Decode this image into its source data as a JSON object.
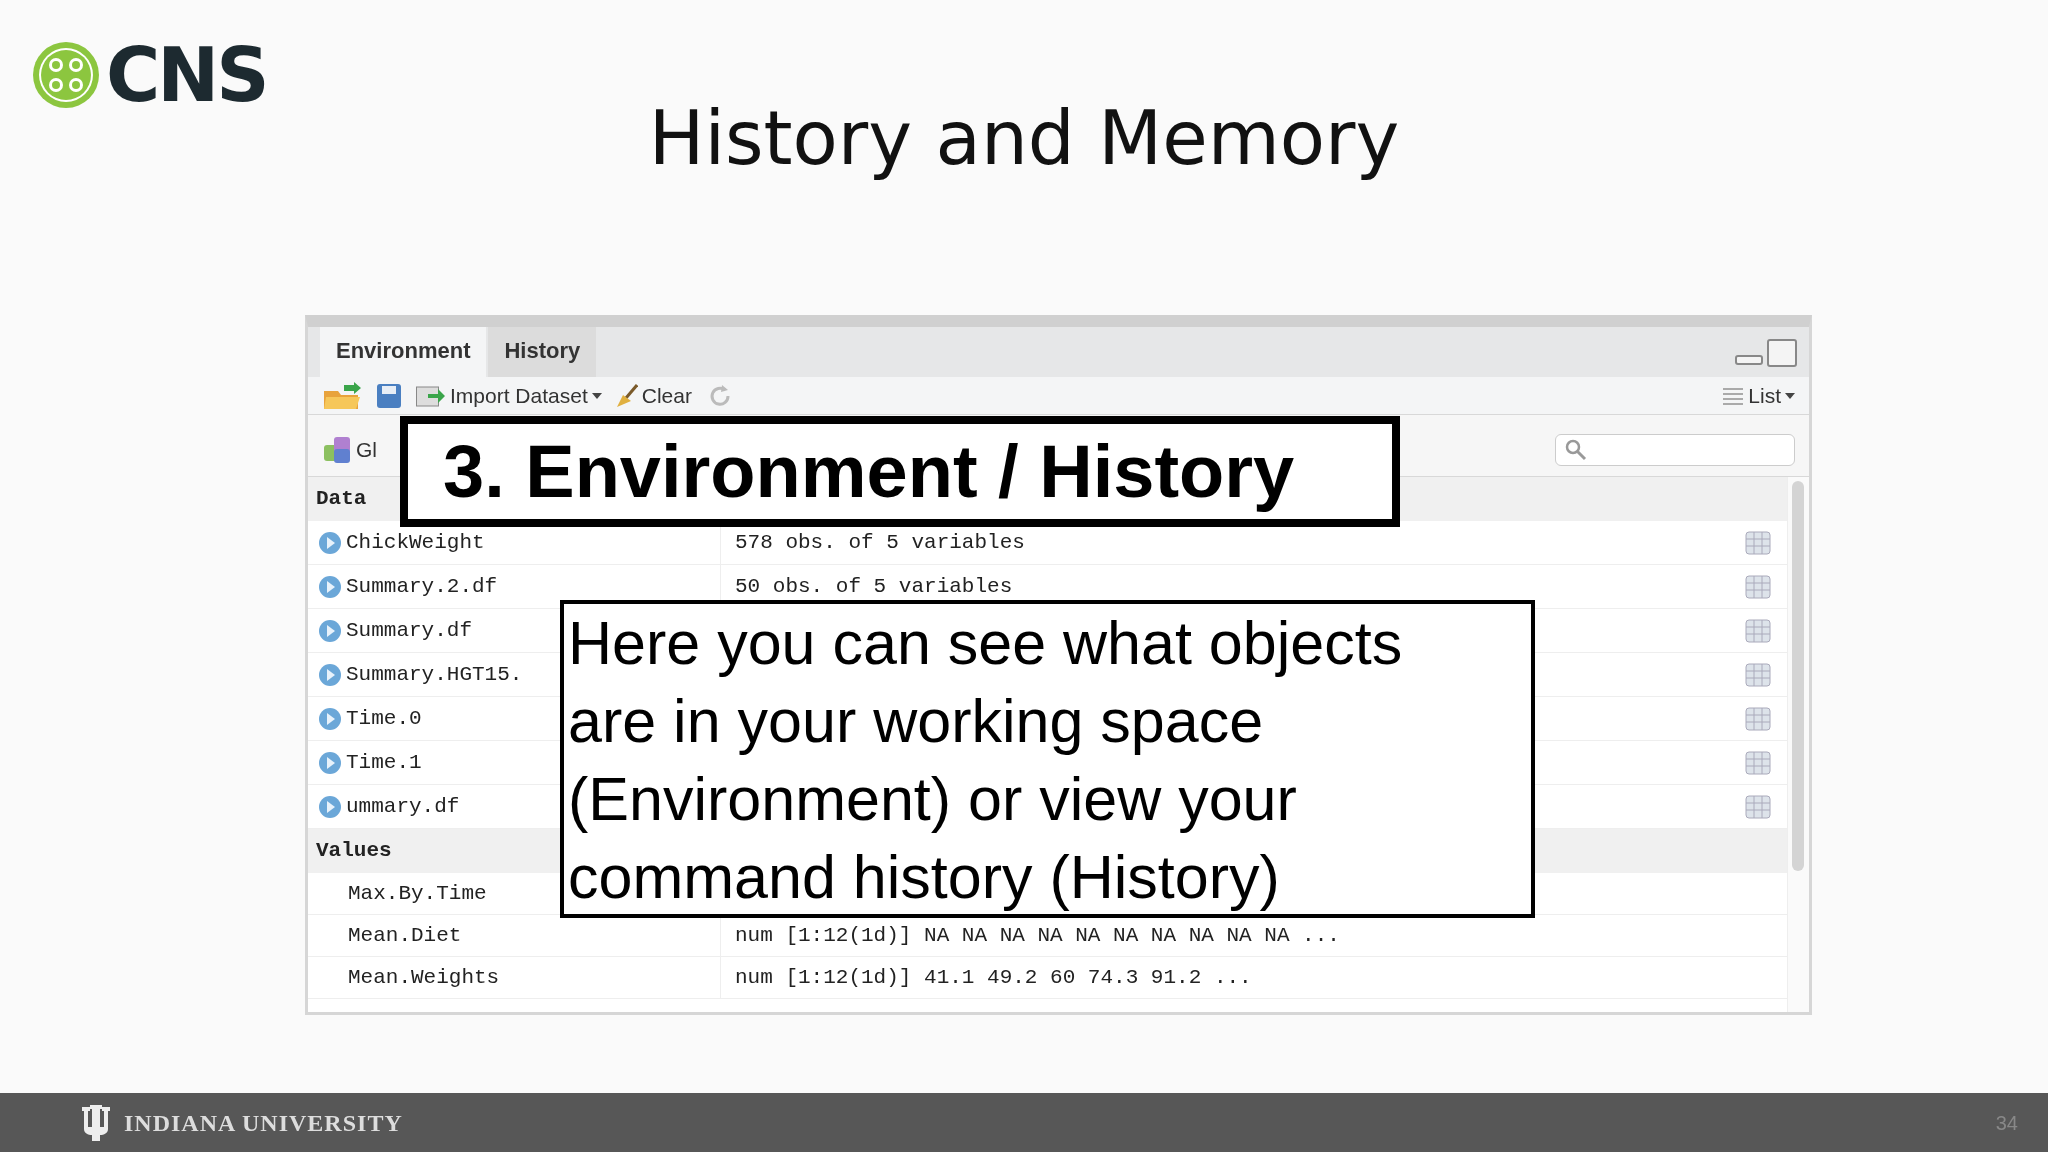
{
  "slide": {
    "logo_text": "CNS",
    "title": "History and Memory",
    "footer_text": "INDIANA UNIVERSITY",
    "page_number": "34"
  },
  "pane": {
    "tabs": [
      {
        "label": "Environment",
        "selected": true
      },
      {
        "label": "History",
        "selected": false
      }
    ],
    "toolbar": {
      "import_label": "Import Dataset",
      "clear_label": "Clear",
      "view_label": "List",
      "environment_label": "Gl"
    },
    "sections": [
      {
        "kind": "data",
        "title": "Data",
        "rows": [
          {
            "name": "ChickWeight",
            "value": "578 obs. of 5 variables"
          },
          {
            "name": "Summary.2.df",
            "value": "50 obs. of 5 variables"
          },
          {
            "name": "Summary.df"
          },
          {
            "name": "Summary.HGT15."
          },
          {
            "name": "Time.0"
          },
          {
            "name": "Time.1"
          },
          {
            "name": "ummary.df"
          }
        ]
      },
      {
        "kind": "values",
        "title": "Values",
        "rows": [
          {
            "name": "Max.By.Time"
          },
          {
            "name": "Mean.Diet",
            "value": "num [1:12(1d)] NA NA NA NA NA NA NA NA NA NA ..."
          },
          {
            "name": "Mean.Weights",
            "value": "num [1:12(1d)] 41.1 49.2 60 74.3 91.2 ..."
          }
        ]
      }
    ]
  },
  "callouts": [
    {
      "kind": "heading",
      "text": "3. Environment / History"
    },
    {
      "kind": "note",
      "text": "Here you can see what objects are in your working space (Environment) or view your command history (History)"
    }
  ]
}
